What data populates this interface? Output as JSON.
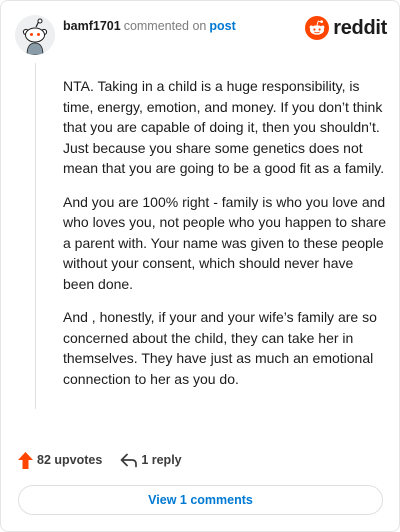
{
  "header": {
    "username": "bamf1701",
    "commented_on": "commented on",
    "post_link": "post",
    "brand": "reddit"
  },
  "comment": {
    "paragraphs": [
      "NTA. Taking in a child is a huge responsibility, is time, energy, emotion, and money. If you don’t think that you are capable of doing it, then you shouldn’t. Just because you share some genetics does not mean that you are going to be a good fit as a family.",
      "And you are 100% right - family is who you love and who loves you, not people who you happen to share a parent with. Your name was given to these people without your consent, which should never have been done.",
      "And , honestly, if your and your wife’s family are so concerned about the child, they can take her in themselves. They have just as much an emotional connection to her as you do."
    ]
  },
  "actions": {
    "upvotes": "82 upvotes",
    "replies": "1 reply",
    "view_comments": "View 1 comments"
  },
  "colors": {
    "upvote_orange": "#ff4500",
    "link_blue": "#0079d3",
    "reddit_orange": "#ff4500"
  },
  "icons": {
    "avatar": "snoo-avatar-icon",
    "brand": "reddit-logo-icon",
    "upvote": "upvote-arrow-icon",
    "reply": "reply-arrow-icon"
  }
}
